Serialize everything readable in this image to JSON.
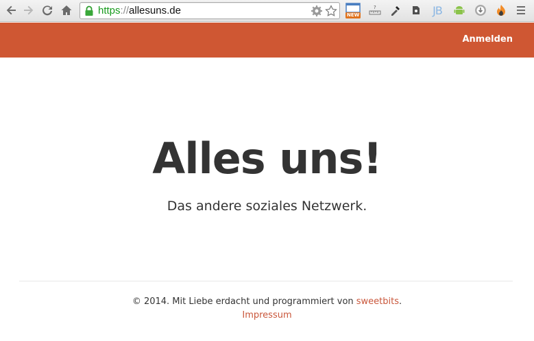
{
  "browser": {
    "url_scheme": "https",
    "url_separator": "://",
    "url_host": "allesuns.de",
    "extension_badge": "NEW",
    "jb_label": "JB"
  },
  "header": {
    "login_label": "Anmelden",
    "bar_color": "#cf5733"
  },
  "hero": {
    "title": "Alles uns!",
    "subtitle": "Das andere soziales Netzwerk."
  },
  "footer": {
    "copyright_text": "© 2014. Mit Liebe erdacht und programmiert von ",
    "author_link": "sweetbits",
    "period": ".",
    "impressum_link": "Impressum",
    "link_color": "#c9563a"
  }
}
